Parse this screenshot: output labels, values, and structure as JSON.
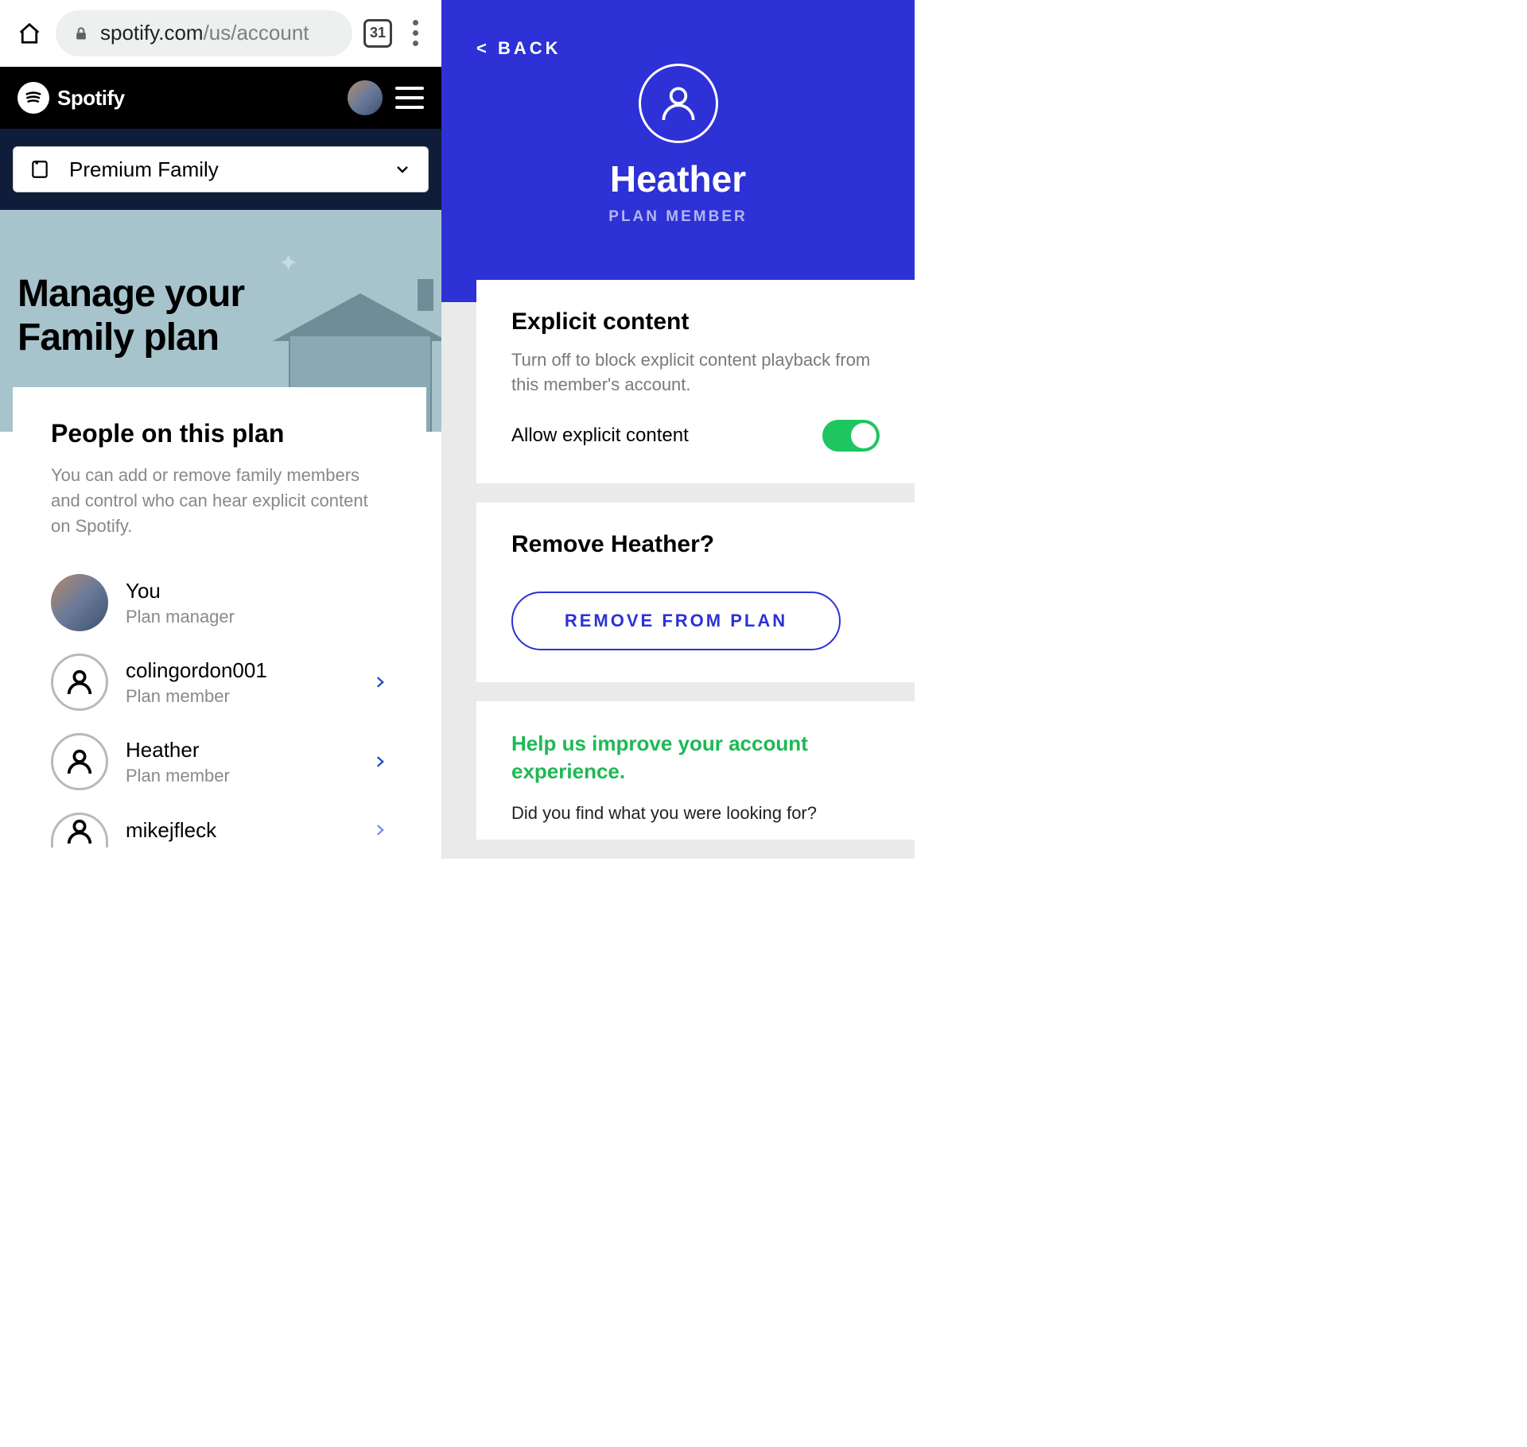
{
  "browser": {
    "url_host": "spotify.com",
    "url_path": "/us/account",
    "tab_count": "31"
  },
  "header": {
    "brand": "Spotify"
  },
  "plan_selector": {
    "label": "Premium Family"
  },
  "banner": {
    "title_line1": "Manage your",
    "title_line2": "Family plan"
  },
  "people": {
    "title": "People on this plan",
    "description": "You can add or remove family members and control who can hear explicit content on Spotify.",
    "members": [
      {
        "name": "You",
        "role": "Plan manager",
        "has_photo": true,
        "has_chevron": false
      },
      {
        "name": "colingordon001",
        "role": "Plan member",
        "has_photo": false,
        "has_chevron": true
      },
      {
        "name": "Heather",
        "role": "Plan member",
        "has_photo": false,
        "has_chevron": true
      },
      {
        "name": "mikejfleck",
        "role": "",
        "has_photo": false,
        "has_chevron": true
      }
    ]
  },
  "detail": {
    "back_label": "< BACK",
    "member_name": "Heather",
    "member_role": "PLAN MEMBER",
    "explicit": {
      "title": "Explicit content",
      "description": "Turn off to block explicit content playback from this member's account.",
      "toggle_label": "Allow explicit content",
      "toggle_on": true
    },
    "remove": {
      "title": "Remove Heather?",
      "button_label": "REMOVE FROM PLAN"
    },
    "feedback": {
      "title": "Help us improve your account experience.",
      "question": "Did you find what you were looking for?"
    }
  },
  "colors": {
    "accent_blue": "#2d31d6",
    "spotify_green": "#1db954",
    "toggle_green": "#1ec65f"
  }
}
